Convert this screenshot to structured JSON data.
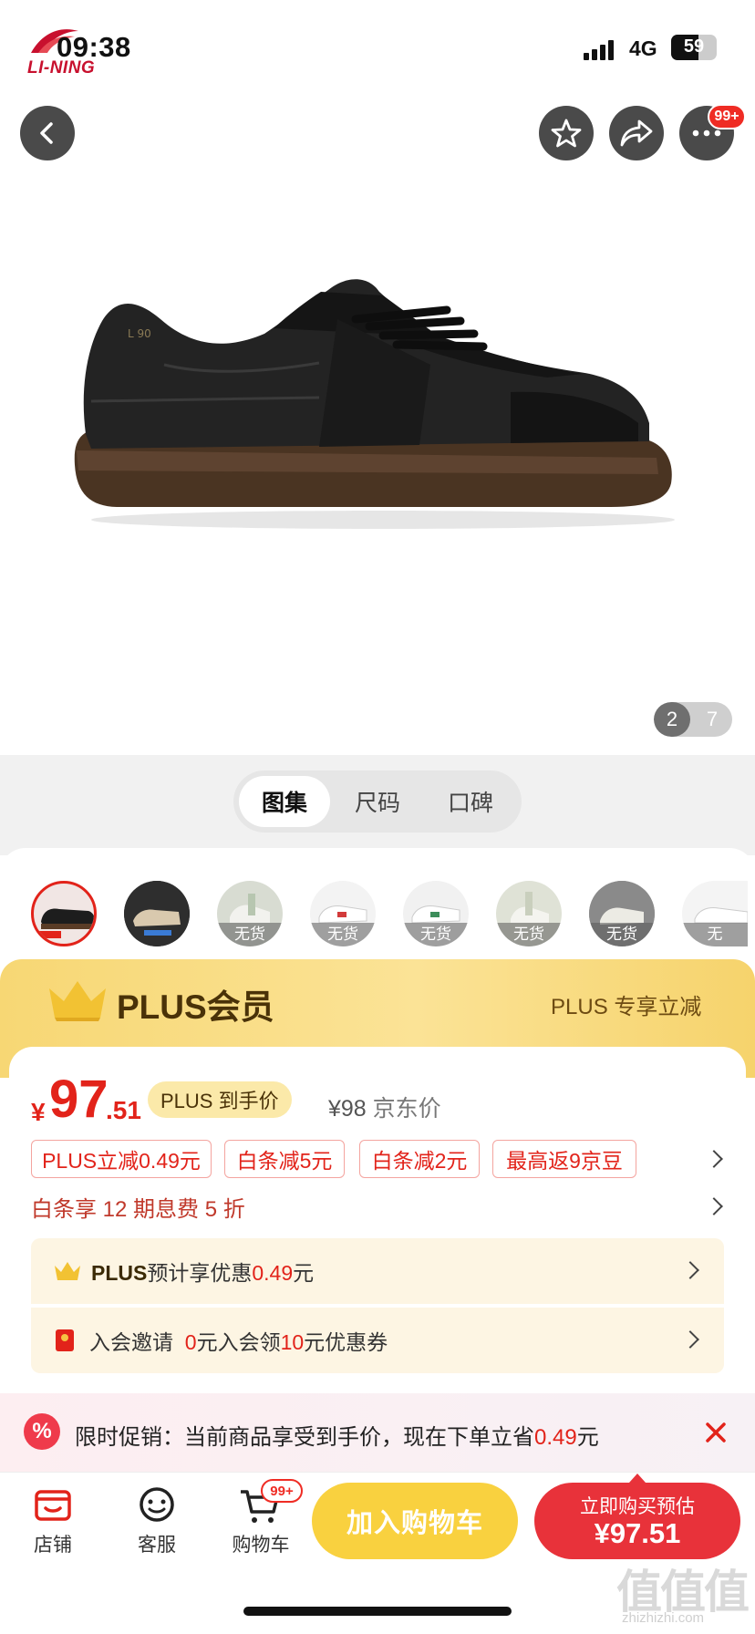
{
  "status_bar": {
    "brand": "LI-NING",
    "time": "09:38",
    "network": "4G",
    "battery": "59",
    "battery_level": 0.59
  },
  "hero": {
    "more_badge": "99+",
    "page_current": "2",
    "page_total": "7"
  },
  "tabs": [
    {
      "label": "图集",
      "active": true
    },
    {
      "label": "尺码",
      "active": false
    },
    {
      "label": "口碑",
      "active": false
    }
  ],
  "variants": [
    {
      "selected": true,
      "stock_label": ""
    },
    {
      "selected": false,
      "stock_label": ""
    },
    {
      "selected": false,
      "stock_label": "无货"
    },
    {
      "selected": false,
      "stock_label": "无货"
    },
    {
      "selected": false,
      "stock_label": "无货"
    },
    {
      "selected": false,
      "stock_label": "无货"
    },
    {
      "selected": false,
      "stock_label": "无货"
    },
    {
      "selected": false,
      "stock_label": "无"
    }
  ],
  "plus_banner": {
    "title": "PLUS会员",
    "right": "PLUS 专享立减"
  },
  "price": {
    "currency": "¥",
    "integer": "97",
    "decimal": ".51",
    "plus_pill": "PLUS 到手价",
    "jd_price": "¥98",
    "jd_label": "京东价"
  },
  "tags": [
    "PLUS立减0.49元",
    "白条减5元",
    "白条减2元",
    "最高返9京豆"
  ],
  "baitiao": "白条享 12 期息费 5 折",
  "plus_row": {
    "prefix": "PLUS",
    "text": "预计享优惠",
    "amount": "0.49",
    "suffix": "元"
  },
  "invite_row": {
    "text1": "入会邀请",
    "amount1": "0",
    "text2": "元入会领",
    "amount2": "10",
    "text3": "元优惠券"
  },
  "promo": {
    "icon": "%",
    "text": "限时促销：当前商品享受到手价，现在下单立省",
    "amount": "0.49",
    "suffix": "元"
  },
  "bottom_nav": {
    "shop": "店铺",
    "service": "客服",
    "cart": "购物车",
    "cart_badge": "99+",
    "add_cart": "加入购物车",
    "buy_line1": "立即购买预估",
    "buy_line2": "¥97.51"
  },
  "watermark": {
    "big": "值值值",
    "small": "zhizhizhi.com"
  },
  "colors": {
    "accent_red": "#e2231a",
    "plus_gold": "#f7d774",
    "cart_yellow": "#f9d13f",
    "buy_red": "#e8323a"
  },
  "icons": [
    "back-arrow-icon",
    "star-icon",
    "share-icon",
    "more-icon",
    "shop-icon",
    "service-icon",
    "cart-icon",
    "crown-icon",
    "red-packet-icon",
    "discount-icon",
    "close-icon",
    "chevron-right-icon"
  ]
}
